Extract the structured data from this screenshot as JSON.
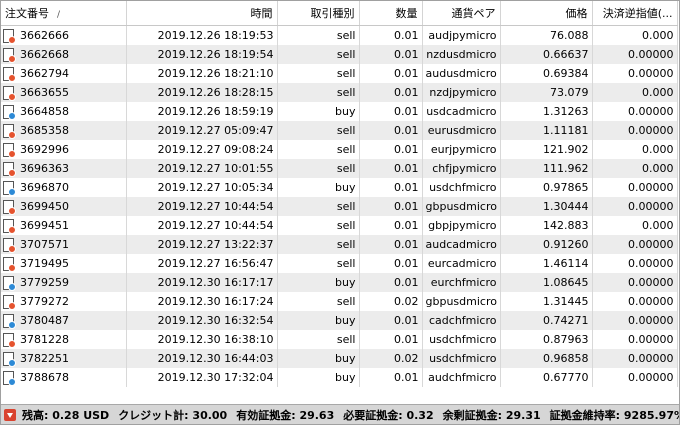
{
  "columns": {
    "ticket": "注文番号",
    "time": "時間",
    "type": "取引種別",
    "size": "数量",
    "symbol": "通貨ペア",
    "price": "価格",
    "sl": "決済逆指値(..."
  },
  "colors": {
    "sell": "#e5532e",
    "buy": "#2d8ad6"
  },
  "rows": [
    {
      "ticket": "3662666",
      "time": "2019.12.26 18:19:53",
      "type": "sell",
      "size": "0.01",
      "symbol": "audjpymicro",
      "price": "76.088",
      "sl": "0.000"
    },
    {
      "ticket": "3662668",
      "time": "2019.12.26 18:19:54",
      "type": "sell",
      "size": "0.01",
      "symbol": "nzdusdmicro",
      "price": "0.66637",
      "sl": "0.00000"
    },
    {
      "ticket": "3662794",
      "time": "2019.12.26 18:21:10",
      "type": "sell",
      "size": "0.01",
      "symbol": "audusdmicro",
      "price": "0.69384",
      "sl": "0.00000"
    },
    {
      "ticket": "3663655",
      "time": "2019.12.26 18:28:15",
      "type": "sell",
      "size": "0.01",
      "symbol": "nzdjpymicro",
      "price": "73.079",
      "sl": "0.000"
    },
    {
      "ticket": "3664858",
      "time": "2019.12.26 18:59:19",
      "type": "buy",
      "size": "0.01",
      "symbol": "usdcadmicro",
      "price": "1.31263",
      "sl": "0.00000"
    },
    {
      "ticket": "3685358",
      "time": "2019.12.27 05:09:47",
      "type": "sell",
      "size": "0.01",
      "symbol": "eurusdmicro",
      "price": "1.11181",
      "sl": "0.00000"
    },
    {
      "ticket": "3692996",
      "time": "2019.12.27 09:08:24",
      "type": "sell",
      "size": "0.01",
      "symbol": "eurjpymicro",
      "price": "121.902",
      "sl": "0.000"
    },
    {
      "ticket": "3696363",
      "time": "2019.12.27 10:01:55",
      "type": "sell",
      "size": "0.01",
      "symbol": "chfjpymicro",
      "price": "111.962",
      "sl": "0.000"
    },
    {
      "ticket": "3696870",
      "time": "2019.12.27 10:05:34",
      "type": "buy",
      "size": "0.01",
      "symbol": "usdchfmicro",
      "price": "0.97865",
      "sl": "0.00000"
    },
    {
      "ticket": "3699450",
      "time": "2019.12.27 10:44:54",
      "type": "sell",
      "size": "0.01",
      "symbol": "gbpusdmicro",
      "price": "1.30444",
      "sl": "0.00000"
    },
    {
      "ticket": "3699451",
      "time": "2019.12.27 10:44:54",
      "type": "sell",
      "size": "0.01",
      "symbol": "gbpjpymicro",
      "price": "142.883",
      "sl": "0.000"
    },
    {
      "ticket": "3707571",
      "time": "2019.12.27 13:22:37",
      "type": "sell",
      "size": "0.01",
      "symbol": "audcadmicro",
      "price": "0.91260",
      "sl": "0.00000"
    },
    {
      "ticket": "3719495",
      "time": "2019.12.27 16:56:47",
      "type": "sell",
      "size": "0.01",
      "symbol": "eurcadmicro",
      "price": "1.46114",
      "sl": "0.00000"
    },
    {
      "ticket": "3779259",
      "time": "2019.12.30 16:17:17",
      "type": "buy",
      "size": "0.01",
      "symbol": "eurchfmicro",
      "price": "1.08645",
      "sl": "0.00000"
    },
    {
      "ticket": "3779272",
      "time": "2019.12.30 16:17:24",
      "type": "sell",
      "size": "0.02",
      "symbol": "gbpusdmicro",
      "price": "1.31445",
      "sl": "0.00000"
    },
    {
      "ticket": "3780487",
      "time": "2019.12.30 16:32:54",
      "type": "buy",
      "size": "0.01",
      "symbol": "cadchfmicro",
      "price": "0.74271",
      "sl": "0.00000"
    },
    {
      "ticket": "3781228",
      "time": "2019.12.30 16:38:10",
      "type": "sell",
      "size": "0.01",
      "symbol": "usdchfmicro",
      "price": "0.87963",
      "sl": "0.00000"
    },
    {
      "ticket": "3782251",
      "time": "2019.12.30 16:44:03",
      "type": "buy",
      "size": "0.02",
      "symbol": "usdchfmicro",
      "price": "0.96858",
      "sl": "0.00000"
    },
    {
      "ticket": "3788678",
      "time": "2019.12.30 17:32:04",
      "type": "buy",
      "size": "0.01",
      "symbol": "audchfmicro",
      "price": "0.67770",
      "sl": "0.00000"
    }
  ],
  "status": {
    "balance": "残高: 0.28 USD",
    "credit": "クレジット計: 30.00",
    "equity": "有効証拠金: 29.63",
    "margin": "必要証拠金: 0.32",
    "free_margin": "余剰証拠金: 29.31",
    "margin_level": "証拠金維持率: 9285.97%"
  }
}
